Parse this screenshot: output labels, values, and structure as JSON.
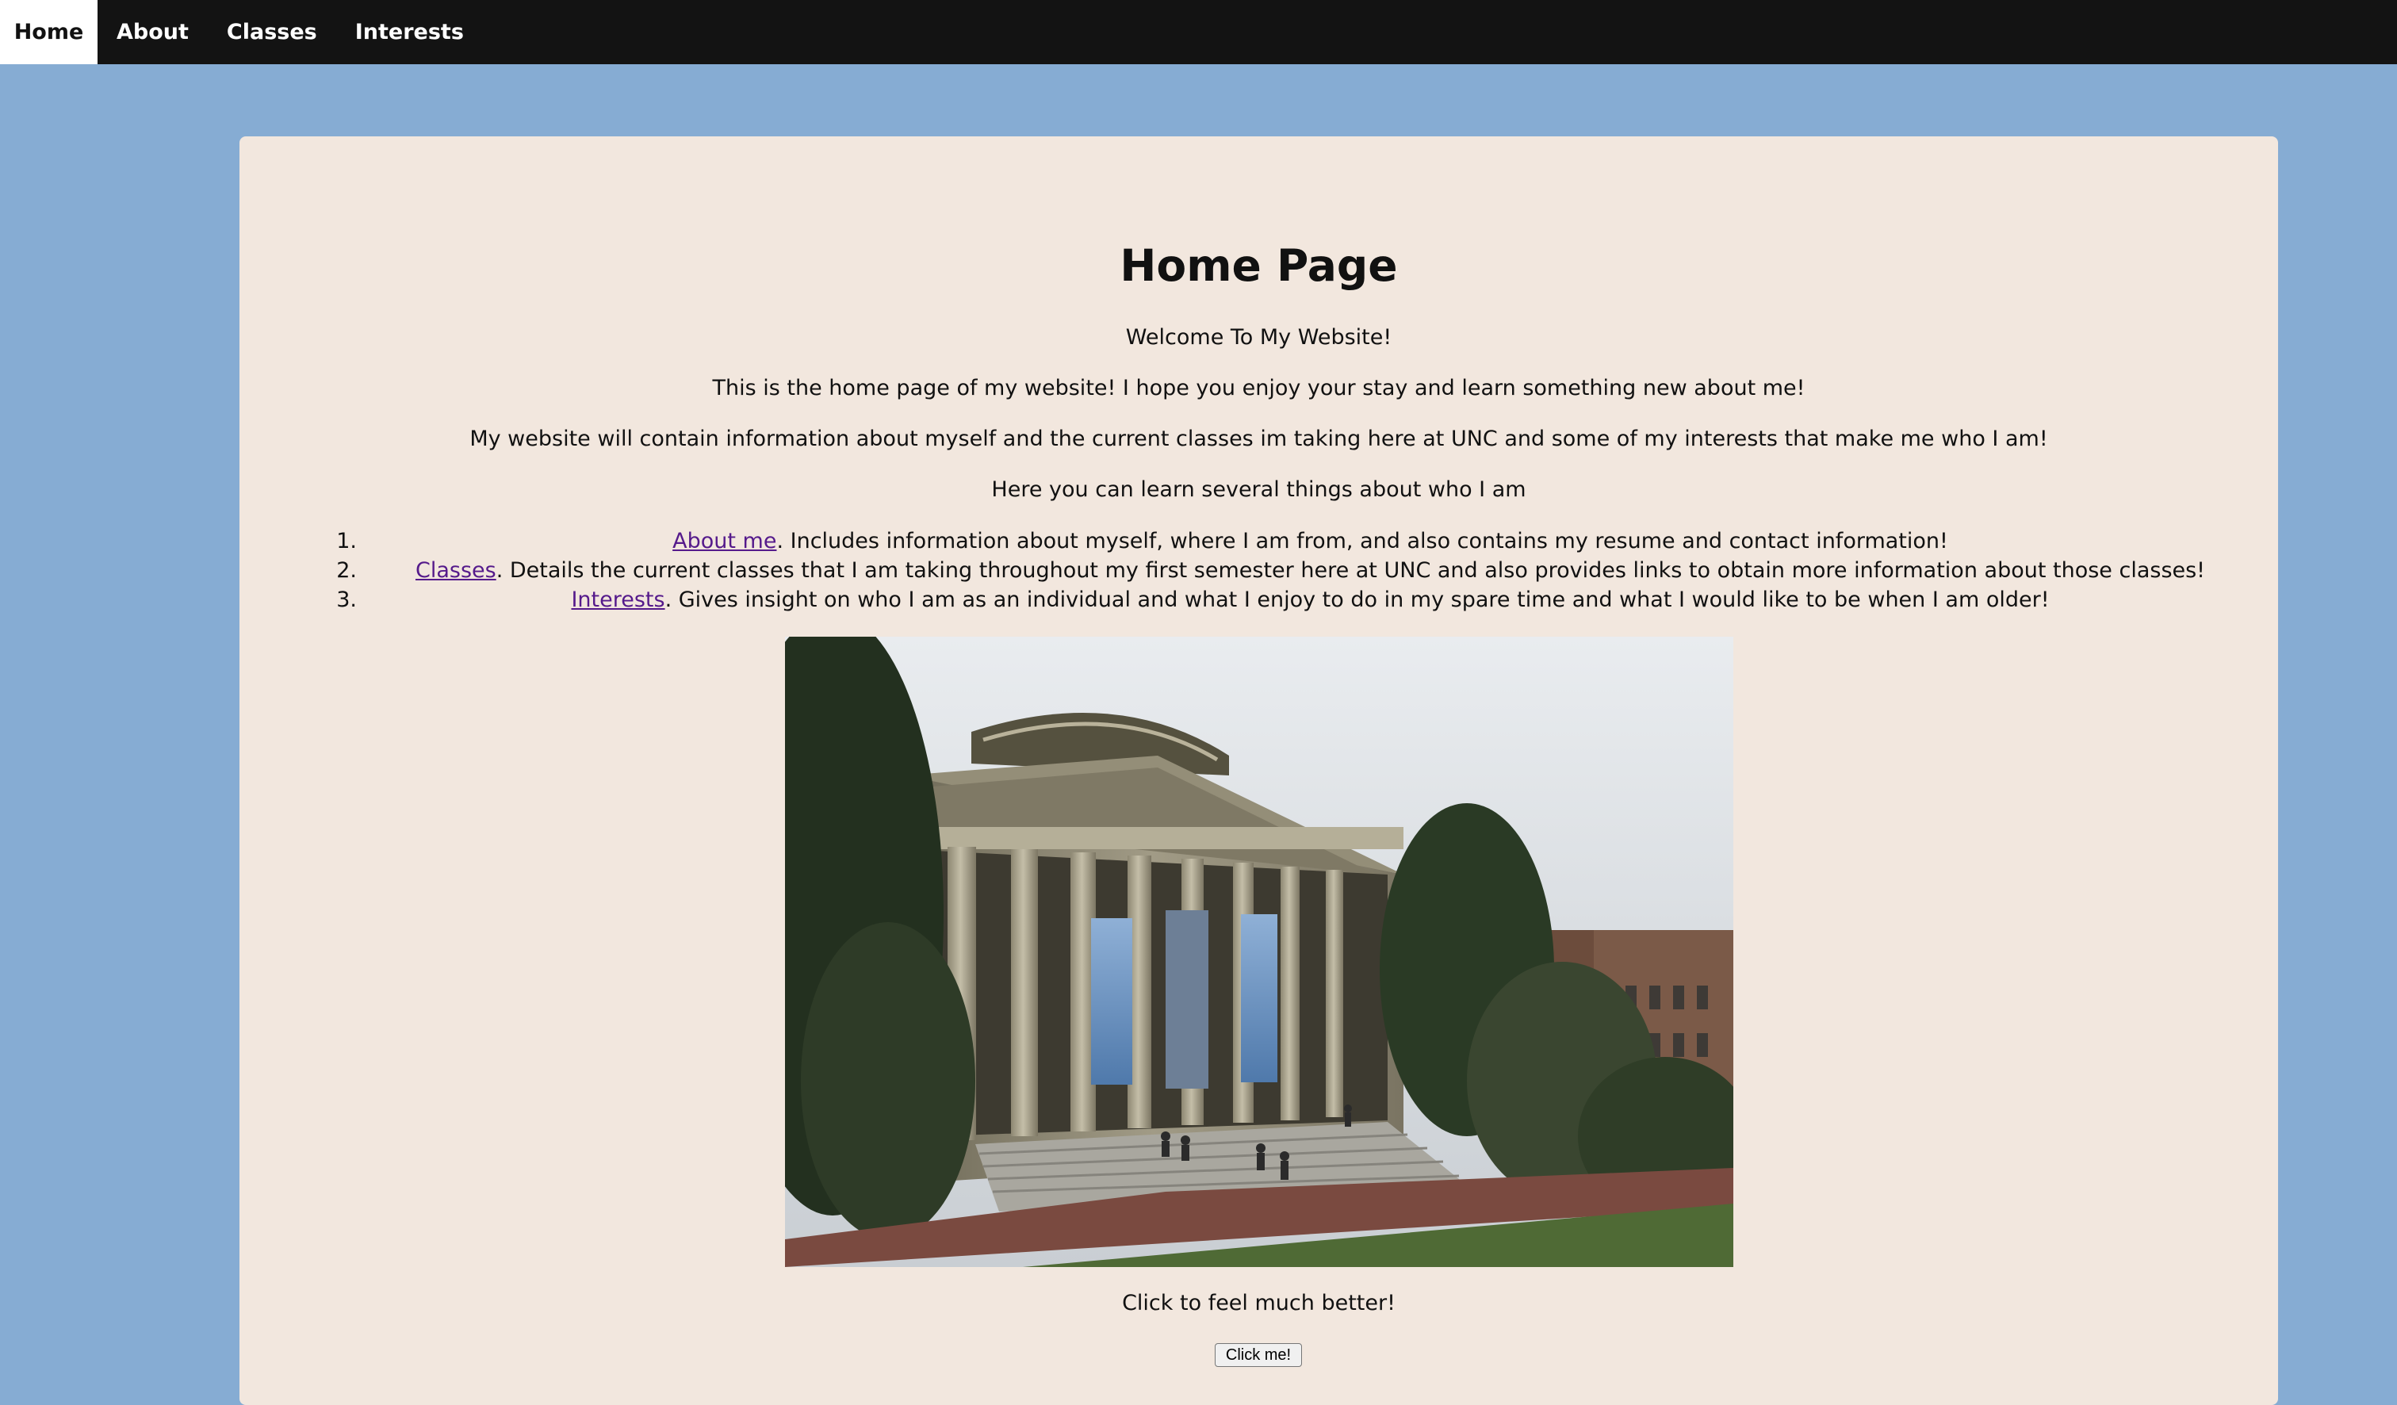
{
  "nav": {
    "items": [
      {
        "label": "Home",
        "active": true
      },
      {
        "label": "About",
        "active": false
      },
      {
        "label": "Classes",
        "active": false
      },
      {
        "label": "Interests",
        "active": false
      }
    ]
  },
  "main": {
    "title": "Home Page",
    "welcome": "Welcome To My Website!",
    "intro": "This is the home page of my website! I hope you enjoy your stay and learn something new about me!",
    "description": "My website will contain information about myself and the current classes im taking here at UNC and some of my interests that make me who I am!",
    "list_heading": "Here you can learn several things about who I am",
    "list": [
      {
        "number": "1.",
        "link": "About me",
        "text": ". Includes information about myself, where I am from, and also contains my resume and contact information!"
      },
      {
        "number": "2.",
        "link": "Classes",
        "text": ". Details the current classes that I am taking throughout my first semester here at UNC and also provides links to obtain more information about those classes!"
      },
      {
        "number": "3.",
        "link": "Interests",
        "text": ". Gives insight on who I am as an individual and what I enjoy to do in my spare time and what I would like to be when I am older!"
      }
    ],
    "cta_text": "Click to feel much better!",
    "button_label": "Click me!"
  },
  "colors": {
    "page_background": "#86acd3",
    "nav_background": "#131313",
    "card_background": "#f2e7de",
    "link": "#551a8b"
  },
  "icons": []
}
